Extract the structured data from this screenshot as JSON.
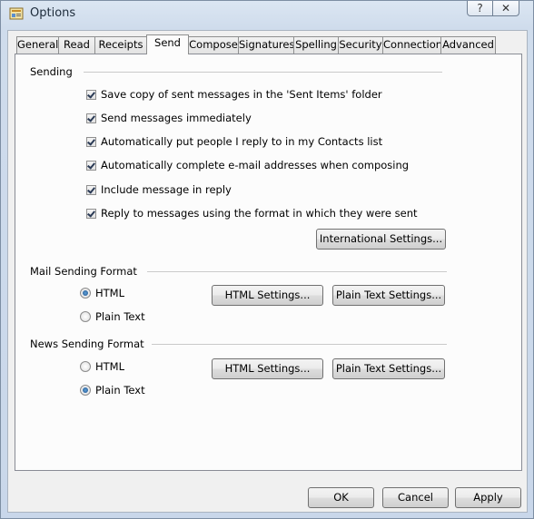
{
  "window": {
    "title": "Options",
    "help_glyph": "?",
    "close_glyph": "✕"
  },
  "tabs": [
    {
      "label": "General"
    },
    {
      "label": "Read"
    },
    {
      "label": "Receipts"
    },
    {
      "label": "Send"
    },
    {
      "label": "Compose"
    },
    {
      "label": "Signatures"
    },
    {
      "label": "Spelling"
    },
    {
      "label": "Security"
    },
    {
      "label": "Connection"
    },
    {
      "label": "Advanced"
    }
  ],
  "active_tab": "Send",
  "sending": {
    "heading": "Sending",
    "options": [
      {
        "label": "Save copy of sent messages in the 'Sent Items' folder",
        "checked": true
      },
      {
        "label": "Send messages immediately",
        "checked": true
      },
      {
        "label": "Automatically put people I reply to in my Contacts list",
        "checked": true
      },
      {
        "label": "Automatically complete e-mail addresses when composing",
        "checked": true
      },
      {
        "label": "Include message in reply",
        "checked": true
      },
      {
        "label": "Reply to messages using the format in which they were sent",
        "checked": true
      }
    ],
    "international_button": "International Settings..."
  },
  "mail_format": {
    "heading": "Mail Sending Format",
    "html_label": "HTML",
    "plain_label": "Plain Text",
    "selected": "HTML",
    "html_settings_button": "HTML Settings...",
    "plain_settings_button": "Plain Text Settings..."
  },
  "news_format": {
    "heading": "News Sending Format",
    "html_label": "HTML",
    "plain_label": "Plain Text",
    "selected": "Plain Text",
    "html_settings_button": "HTML Settings...",
    "plain_settings_button": "Plain Text Settings..."
  },
  "footer": {
    "ok": "OK",
    "cancel": "Cancel",
    "apply": "Apply"
  }
}
